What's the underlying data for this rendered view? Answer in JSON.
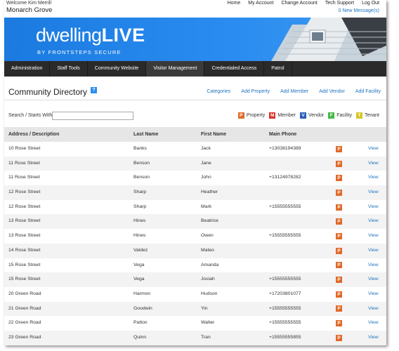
{
  "top": {
    "welcome": "Welcome Kim Merrill",
    "site_name": "Monarch Grove",
    "links": [
      "Home",
      "My Account",
      "Change Account",
      "Tech Support",
      "Log Out"
    ],
    "messages": "0 New Message(s)"
  },
  "banner": {
    "logo_main": "dwelling",
    "logo_bold": "LIVE",
    "byline": "BY FRONTSTEPS SECURE"
  },
  "nav": [
    "Administration",
    "Staff Tools",
    "Community Website",
    "Visitor Management",
    "Credentialed Access",
    "Patrol"
  ],
  "page": {
    "title": "Community Directory",
    "help": "?",
    "actions": [
      "Categories",
      "Add Property",
      "Add Member",
      "Add Vendor",
      "Add Facility"
    ]
  },
  "search": {
    "label": "Search / Starts With:",
    "value": "",
    "placeholder": ""
  },
  "legend": [
    {
      "letter": "P",
      "label": "Property",
      "color": "#e06a2a"
    },
    {
      "letter": "M",
      "label": "Member",
      "color": "#d9302c"
    },
    {
      "letter": "V",
      "label": "Vendor",
      "color": "#2a5fb8"
    },
    {
      "letter": "F",
      "label": "Facility",
      "color": "#45b845"
    },
    {
      "letter": "T",
      "label": "Tenant",
      "color": "#d8c62a"
    }
  ],
  "table": {
    "headers": [
      "Address / Description",
      "Last Name",
      "First Name",
      "Main Phone"
    ],
    "rows": [
      {
        "address": "10 Rose Street",
        "last": "Banks",
        "first": "Jack",
        "phone": "+13038194389",
        "type": "P",
        "action": "View"
      },
      {
        "address": "11 Rose Street",
        "last": "Benson",
        "first": "Jane",
        "phone": "",
        "type": "P",
        "action": "View"
      },
      {
        "address": "11 Rose Street",
        "last": "Benson",
        "first": "John",
        "phone": "+13124978282",
        "type": "P",
        "action": "View"
      },
      {
        "address": "12 Rose Street",
        "last": "Sharp",
        "first": "Heather",
        "phone": "",
        "type": "P",
        "action": "View"
      },
      {
        "address": "12 Rose Street",
        "last": "Sharp",
        "first": "Mark",
        "phone": "+15555555555",
        "type": "P",
        "action": "View"
      },
      {
        "address": "13 Rose Street",
        "last": "Hines",
        "first": "Beatrice",
        "phone": "",
        "type": "P",
        "action": "View"
      },
      {
        "address": "13 Rose Street",
        "last": "Hines",
        "first": "Owen",
        "phone": "+15555555555",
        "type": "P",
        "action": "View"
      },
      {
        "address": "14 Rose Street",
        "last": "Valdez",
        "first": "Mateo",
        "phone": "",
        "type": "P",
        "action": "View"
      },
      {
        "address": "15 Rose Street",
        "last": "Vega",
        "first": "Amanda",
        "phone": "",
        "type": "P",
        "action": "View"
      },
      {
        "address": "15 Rose Street",
        "last": "Vega",
        "first": "Josiah",
        "phone": "+15555555555",
        "type": "P",
        "action": "View"
      },
      {
        "address": "20 Green Road",
        "last": "Harmon",
        "first": "Hudson",
        "phone": "+17203801077",
        "type": "P",
        "action": "View"
      },
      {
        "address": "21 Green Road",
        "last": "Goodwin",
        "first": "Yin",
        "phone": "+15555555555",
        "type": "P",
        "action": "View"
      },
      {
        "address": "22 Green Road",
        "last": "Patton",
        "first": "Walter",
        "phone": "+15555555555",
        "type": "P",
        "action": "View"
      },
      {
        "address": "23 Green Road",
        "last": "Quinn",
        "first": "Tran",
        "phone": "+15555555855",
        "type": "P",
        "action": "View"
      }
    ]
  }
}
